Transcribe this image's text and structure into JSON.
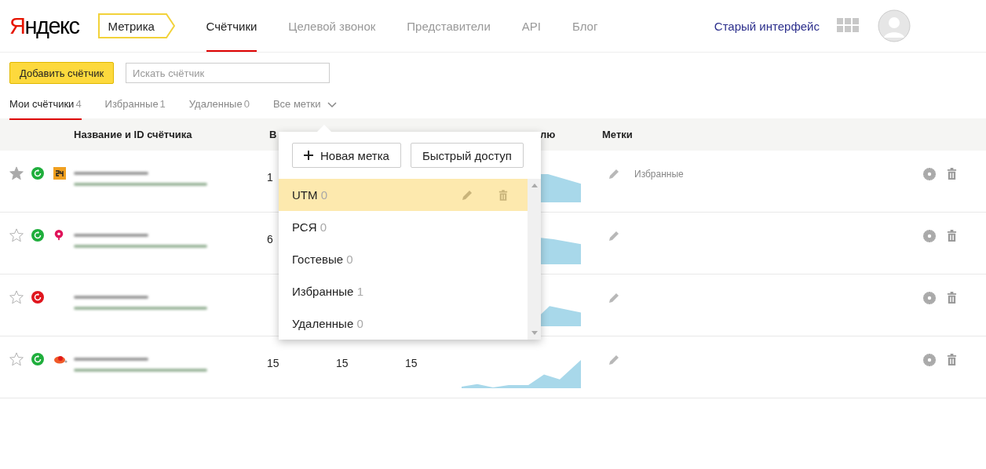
{
  "header": {
    "logo": "Яндекс",
    "product": "Метрика",
    "nav": [
      {
        "label": "Счётчики",
        "selected": true
      },
      {
        "label": "Целевой звонок",
        "selected": false
      },
      {
        "label": "Представители",
        "selected": false
      },
      {
        "label": "API",
        "selected": false
      },
      {
        "label": "Блог",
        "selected": false
      }
    ],
    "old_interface_link": "Старый интерфейс"
  },
  "toolbar": {
    "add_button": "Добавить счётчик",
    "search": {
      "placeholder": "Искать счётчик"
    }
  },
  "filter_tabs": [
    {
      "label": "Мои счётчики",
      "count": "4",
      "selected": true
    },
    {
      "label": "Избранные",
      "count": "1",
      "selected": false
    },
    {
      "label": "Удаленные",
      "count": "0",
      "selected": false
    }
  ],
  "tags_dropdown": {
    "label": "Все метки",
    "new_button": "Новая метка",
    "quick_button": "Быстрый доступ",
    "items": [
      {
        "label": "UTM",
        "count": "0",
        "selected": true
      },
      {
        "label": "РСЯ",
        "count": "0",
        "selected": false
      },
      {
        "label": "Гостевые",
        "count": "0",
        "selected": false
      },
      {
        "label": "Избранные",
        "count": "1",
        "selected": false
      },
      {
        "label": "Удаленные",
        "count": "0",
        "selected": false
      }
    ]
  },
  "table": {
    "columns": [
      "Название и ID счётчика",
      "В",
      "лю",
      "Метки"
    ],
    "rows": [
      {
        "favorite": true,
        "color": "#1fae3c",
        "favicon": {
          "kind": "badge"
        },
        "visits": "1",
        "tag": "Избранные"
      },
      {
        "favorite": false,
        "color": "#1fae3c",
        "favicon": {
          "kind": "pin"
        },
        "visits": "6"
      },
      {
        "favorite": false,
        "color": "#e0161e"
      },
      {
        "favorite": false,
        "color": "#1fae3c",
        "favicon": {
          "kind": "cloud"
        },
        "visits": "15",
        "column_3": "15",
        "column_4": "15"
      }
    ]
  }
}
